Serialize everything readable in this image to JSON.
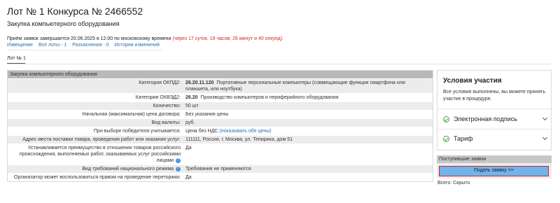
{
  "header": {
    "title": "Лот № 1 Конкурса № 2466552",
    "subtitle": "Закупка компьютерного оборудования"
  },
  "deadline": {
    "text": "Приём заявок завершается 20.06.2025 в 12:00 по московскому времени ",
    "remaining": "(через 17 суток, 19 часов, 26 минут и 40 секунд)."
  },
  "links": [
    "Извещение",
    "Все лоты - 1",
    "Разъяснения - 0",
    "История изменений"
  ],
  "tab": "Лот № 1",
  "table": {
    "head": "Закупка компьютерного оборудования",
    "rows": [
      {
        "label": "Категория ОКПД2:",
        "code": "26.20.11.120",
        "value": "Портативные персональные компьютеры (совмещающие функции смартфона или планшета, или ноутбука)"
      },
      {
        "label": "Категория ОКВЭД2:",
        "code": "26.20",
        "value": "Производство компьютеров и периферийного оборудования"
      },
      {
        "label": "Количество:",
        "value": "50 шт"
      },
      {
        "label": "Начальная (максимальная) цена договора:",
        "value": "Без указания цены"
      },
      {
        "label": "Вид валюты:",
        "value": "руб."
      },
      {
        "label": "При выборе победителя учитывается:",
        "value": "Цена без НДС ",
        "link": "(показывать обе цены)"
      },
      {
        "label": "Адрес места поставки товара, проведения работ или оказания услуг:",
        "value": "111111, Россия, г. Москва, ул. Тепирика, дом 51"
      },
      {
        "label": "Устанавливается преимущество в отношении товаров российского происхождения, выполняемых работ, оказываемых услуг российскими лицами",
        "value": "Да"
      },
      {
        "label": "Вид требований национального режима",
        "value": "Требования не применяются"
      },
      {
        "label": "Организатор может воспользоваться правом на проведение переторжки:",
        "value": "Да"
      }
    ]
  },
  "conditions": {
    "title": "Условия участия",
    "desc": "Все условия выполнены, вы можете принять участие в процедуре.",
    "items": [
      "Электронная подпись",
      "Тариф"
    ]
  },
  "applications": {
    "head": "Поступившие заявки",
    "submit": "Подать заявку >>",
    "total": "Всего: Скрыто"
  }
}
